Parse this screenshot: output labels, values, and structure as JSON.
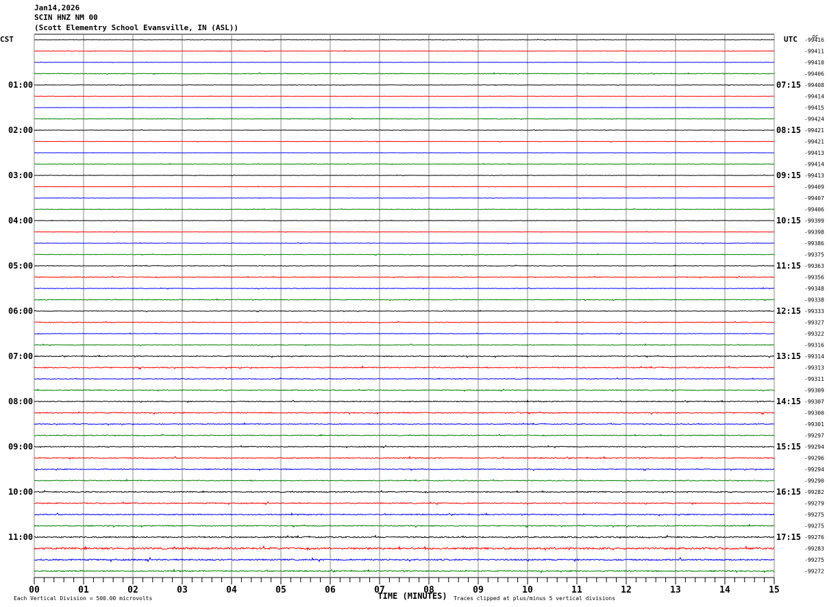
{
  "header": {
    "date": "Jan14,2026",
    "station": "SCIN HNZ NM 00",
    "location": "(Scott Elementry School Evansville, IN (ASL))"
  },
  "chart_data": {
    "type": "line",
    "subtype": "helicorder",
    "left_axis_title": "CST",
    "right_axis_title": "UTC",
    "dc_title": "DC",
    "xlabel": "TIME (MINUTES)",
    "xlim": [
      0,
      15
    ],
    "x_ticks": [
      "00",
      "01",
      "02",
      "03",
      "04",
      "05",
      "06",
      "07",
      "08",
      "09",
      "10",
      "11",
      "12",
      "13",
      "14",
      "15"
    ],
    "minutes_per_row": 15,
    "left_labels": [
      {
        "row": 4,
        "text": "01:00"
      },
      {
        "row": 8,
        "text": "02:00"
      },
      {
        "row": 12,
        "text": "03:00"
      },
      {
        "row": 16,
        "text": "04:00"
      },
      {
        "row": 20,
        "text": "05:00"
      },
      {
        "row": 24,
        "text": "06:00"
      },
      {
        "row": 28,
        "text": "07:00"
      },
      {
        "row": 32,
        "text": "08:00"
      },
      {
        "row": 36,
        "text": "09:00"
      },
      {
        "row": 40,
        "text": "10:00"
      },
      {
        "row": 44,
        "text": "11:00"
      }
    ],
    "right_labels": [
      {
        "row": 4,
        "text": "07:15"
      },
      {
        "row": 8,
        "text": "08:15"
      },
      {
        "row": 12,
        "text": "09:15"
      },
      {
        "row": 16,
        "text": "10:15"
      },
      {
        "row": 20,
        "text": "11:15"
      },
      {
        "row": 24,
        "text": "12:15"
      },
      {
        "row": 28,
        "text": "13:15"
      },
      {
        "row": 32,
        "text": "14:15"
      },
      {
        "row": 36,
        "text": "15:15"
      },
      {
        "row": 40,
        "text": "16:15"
      },
      {
        "row": 44,
        "text": "17:15"
      }
    ],
    "dc_offsets": [
      "-99416",
      "-99411",
      "-99410",
      "-99406",
      "-99408",
      "-99414",
      "-99415",
      "-99424",
      "-99421",
      "-99421",
      "-99413",
      "-99414",
      "-99413",
      "-99409",
      "-99407",
      "-99406",
      "-99399",
      "-99398",
      "-99386",
      "-99375",
      "-99363",
      "-99356",
      "-99348",
      "-99338",
      "-99333",
      "-99327",
      "-99322",
      "-99316",
      "-99314",
      "-99313",
      "-99311",
      "-99309",
      "-99307",
      "-99300",
      "-99301",
      "-99297",
      "-99294",
      "-99296",
      "-99294",
      "-99290",
      "-99282",
      "-99279",
      "-99275",
      "-99275",
      "-99276",
      "-99283",
      "-99275",
      "-99272"
    ],
    "trace_colors": [
      "#000000",
      "#ff0000",
      "#0000ff",
      "#008000"
    ],
    "noise_levels": [
      0.3,
      0.3,
      0.2,
      0.5,
      0.3,
      0.3,
      0.2,
      0.4,
      0.3,
      0.3,
      0.2,
      0.4,
      0.3,
      0.3,
      0.2,
      0.4,
      0.3,
      0.3,
      0.3,
      0.4,
      0.4,
      0.5,
      0.4,
      0.5,
      0.4,
      0.5,
      0.4,
      0.5,
      0.6,
      0.7,
      0.5,
      0.6,
      0.6,
      0.7,
      0.6,
      0.6,
      0.6,
      0.7,
      0.6,
      0.6,
      0.7,
      0.7,
      0.7,
      0.7,
      0.9,
      1.2,
      1.0,
      0.8
    ],
    "scale_note": "Each Vertical Division =  500.00 microvolts",
    "clip_note": "Traces clipped at plus/minus 5 vertical divisions"
  }
}
